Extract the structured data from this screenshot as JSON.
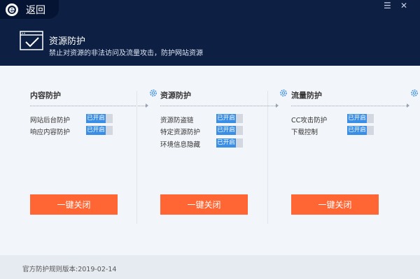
{
  "header": {
    "back_label": "返回",
    "minimize_glyph": "☰",
    "close_glyph": "✕",
    "title": "资源防护",
    "description": "禁止对资源的非法访问及流量攻击，防护网站资源"
  },
  "panels": [
    {
      "title": "内容防护",
      "rows": [
        {
          "label": "网站后台防护",
          "status": "已开启"
        },
        {
          "label": "响应内容防护",
          "status": "已开启"
        }
      ],
      "button": "一键关闭"
    },
    {
      "title": "资源防护",
      "rows": [
        {
          "label": "资源防盗链",
          "status": "已开启"
        },
        {
          "label": "特定资源防护",
          "status": "已开启"
        },
        {
          "label": "环境信息隐藏",
          "status": "已开启"
        }
      ],
      "button": "一键关闭"
    },
    {
      "title": "流量防护",
      "rows": [
        {
          "label": "CC攻击防护",
          "status": "已开启"
        },
        {
          "label": "下载控制",
          "status": "已开启"
        }
      ],
      "button": "一键关闭"
    }
  ],
  "footer": {
    "version_text": "官方防护规则版本:2019-02-14"
  },
  "colors": {
    "header_bg": "#0d2044",
    "accent_blue": "#3a8ee6",
    "button_orange": "#ff6633"
  }
}
